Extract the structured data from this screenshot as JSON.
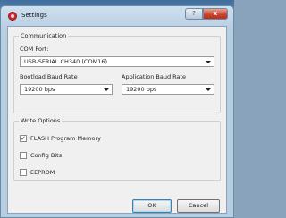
{
  "window": {
    "title": "Settings",
    "help_label": "?",
    "close_label": "x"
  },
  "communication": {
    "group_title": "Communication",
    "com_port_label": "COM Port:",
    "com_port_value": "USB-SERIAL CH340 (COM16)",
    "bootload_baud_label": "Bootload Baud Rate",
    "bootload_baud_value": "19200 bps",
    "application_baud_label": "Application Baud Rate",
    "application_baud_value": "19200 bps"
  },
  "write_options": {
    "group_title": "Write Options",
    "items": [
      {
        "label": "FLASH Program Memory",
        "checked": true
      },
      {
        "label": "Config Bits",
        "checked": false
      },
      {
        "label": "EEPROM",
        "checked": false
      }
    ]
  },
  "buttons": {
    "ok_label": "OK",
    "cancel_label": "Cancel"
  },
  "colors": {
    "close_button": "#c9462e",
    "title_bar": "#cfe0ef",
    "dialog_bg": "#f0f0f0"
  }
}
